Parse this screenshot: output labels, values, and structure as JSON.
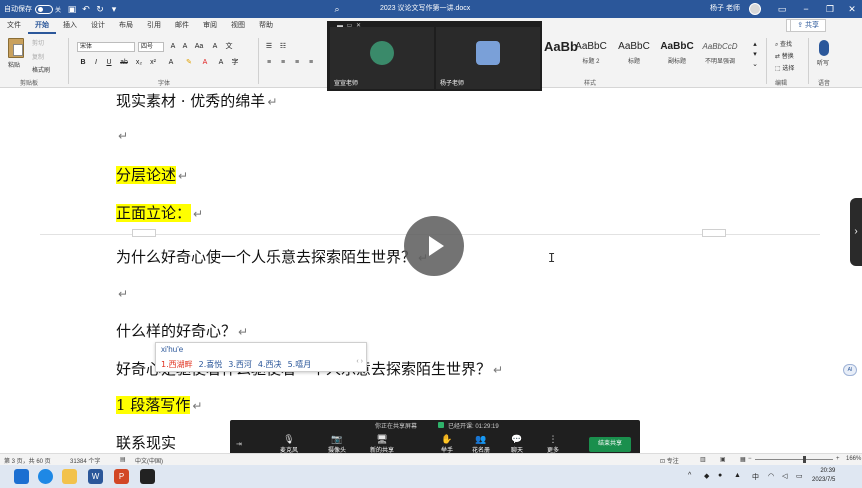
{
  "titlebar": {
    "autosave_label": "自动保存",
    "autosave_state": "关",
    "doc_title": "2023 议论文写作第一讲.docx",
    "user_name": "杨子 老师",
    "accent": "#2b579a"
  },
  "ribbon_tabs": [
    "文件",
    "开始",
    "插入",
    "设计",
    "布局",
    "引用",
    "邮件",
    "审阅",
    "视图",
    "帮助"
  ],
  "ribbon_active_tab": "开始",
  "share_label": "共享",
  "clipboard": {
    "paste": "粘贴",
    "cut": "剪切",
    "copy": "复制",
    "format_painter": "格式刷",
    "group": "剪贴板"
  },
  "font": {
    "name": "宋体",
    "size": "四号",
    "group": "字体"
  },
  "styles": {
    "items": [
      {
        "sample": "AaBb",
        "name": ""
      },
      {
        "sample": "AaBbC",
        "name": "标题 2"
      },
      {
        "sample": "AaBbC",
        "name": "标题"
      },
      {
        "sample": "AaBbC",
        "name": "副标题"
      },
      {
        "sample": "AaBbCcD",
        "name": "不明显强调"
      }
    ],
    "group": "样式"
  },
  "editing": {
    "find": "查找",
    "replace": "替换",
    "select": "选择",
    "group": "编辑"
  },
  "voice": {
    "label": "听写",
    "group": "语音"
  },
  "video": {
    "tiles": [
      {
        "name": "宣宣老师",
        "avatar_color": "#3a8a6a"
      },
      {
        "name": "杨子老师",
        "avatar_color": "#7aa0d8"
      }
    ]
  },
  "document": {
    "paragraphs": [
      {
        "text": "现实素材 · 优秀的绵羊",
        "highlight": false
      },
      {
        "text": "",
        "highlight": false
      },
      {
        "text": "分层论述",
        "highlight": true
      },
      {
        "text": "正面立论：",
        "highlight": true
      },
      {
        "text": "为什么好奇心使一个人乐意去探索陌生世界？",
        "highlight": false
      },
      {
        "text": "",
        "highlight": false
      },
      {
        "text": "什么样的好奇心？",
        "highlight": false
      },
      {
        "text": "好奇心是驱使着什么驱使着一个人乐意去探索陌生世界？",
        "highlight": false
      },
      {
        "text": "1 段落写作",
        "highlight": true
      },
      {
        "text": "联系现实",
        "highlight": false
      }
    ],
    "para_mark": "↵"
  },
  "ime": {
    "pinyin": "xi'hu'e",
    "candidates": [
      "1.西湖畔",
      "2.喜悦",
      "3.西河",
      "4.西决",
      "5.嘻月"
    ]
  },
  "meeting": {
    "share_note": "你正在共享屏幕",
    "elapsed_label": "已经开课: 01:29:19",
    "items": [
      {
        "icon": "mic-icon",
        "glyph": "🎤",
        "label": "麦克风"
      },
      {
        "icon": "camera-icon",
        "glyph": "📷",
        "label": "摄像头"
      },
      {
        "icon": "share-screen-icon",
        "glyph": "🖥",
        "label": "新的共享"
      },
      {
        "icon": "raise-hand-icon",
        "glyph": "✋",
        "label": "举手"
      },
      {
        "icon": "participants-icon",
        "glyph": "👥",
        "label": "花名册"
      },
      {
        "icon": "chat-icon",
        "glyph": "💬",
        "label": "聊天"
      },
      {
        "icon": "more-icon",
        "glyph": "⋮",
        "label": "更多"
      }
    ],
    "end_label": "结束共享"
  },
  "statusbar": {
    "page": "第 3 页，共 60 页",
    "words": "31384 个字",
    "lang": "中文(中国)",
    "focus": "专注",
    "zoom": "166%"
  },
  "taskbar": {
    "time": "20:39",
    "date": "2023/7/5",
    "apps": [
      {
        "name": "windows-icon",
        "color": "#1c6fd1"
      },
      {
        "name": "search-icon",
        "color": "#ffffff"
      },
      {
        "name": "edge-icon",
        "color": "#1e88e5"
      },
      {
        "name": "file-explorer-icon",
        "color": "#f2c24c"
      },
      {
        "name": "word-icon",
        "color": "#2b579a"
      },
      {
        "name": "powerpoint-icon",
        "color": "#d24726"
      },
      {
        "name": "app-icon",
        "color": "#222222"
      }
    ]
  }
}
